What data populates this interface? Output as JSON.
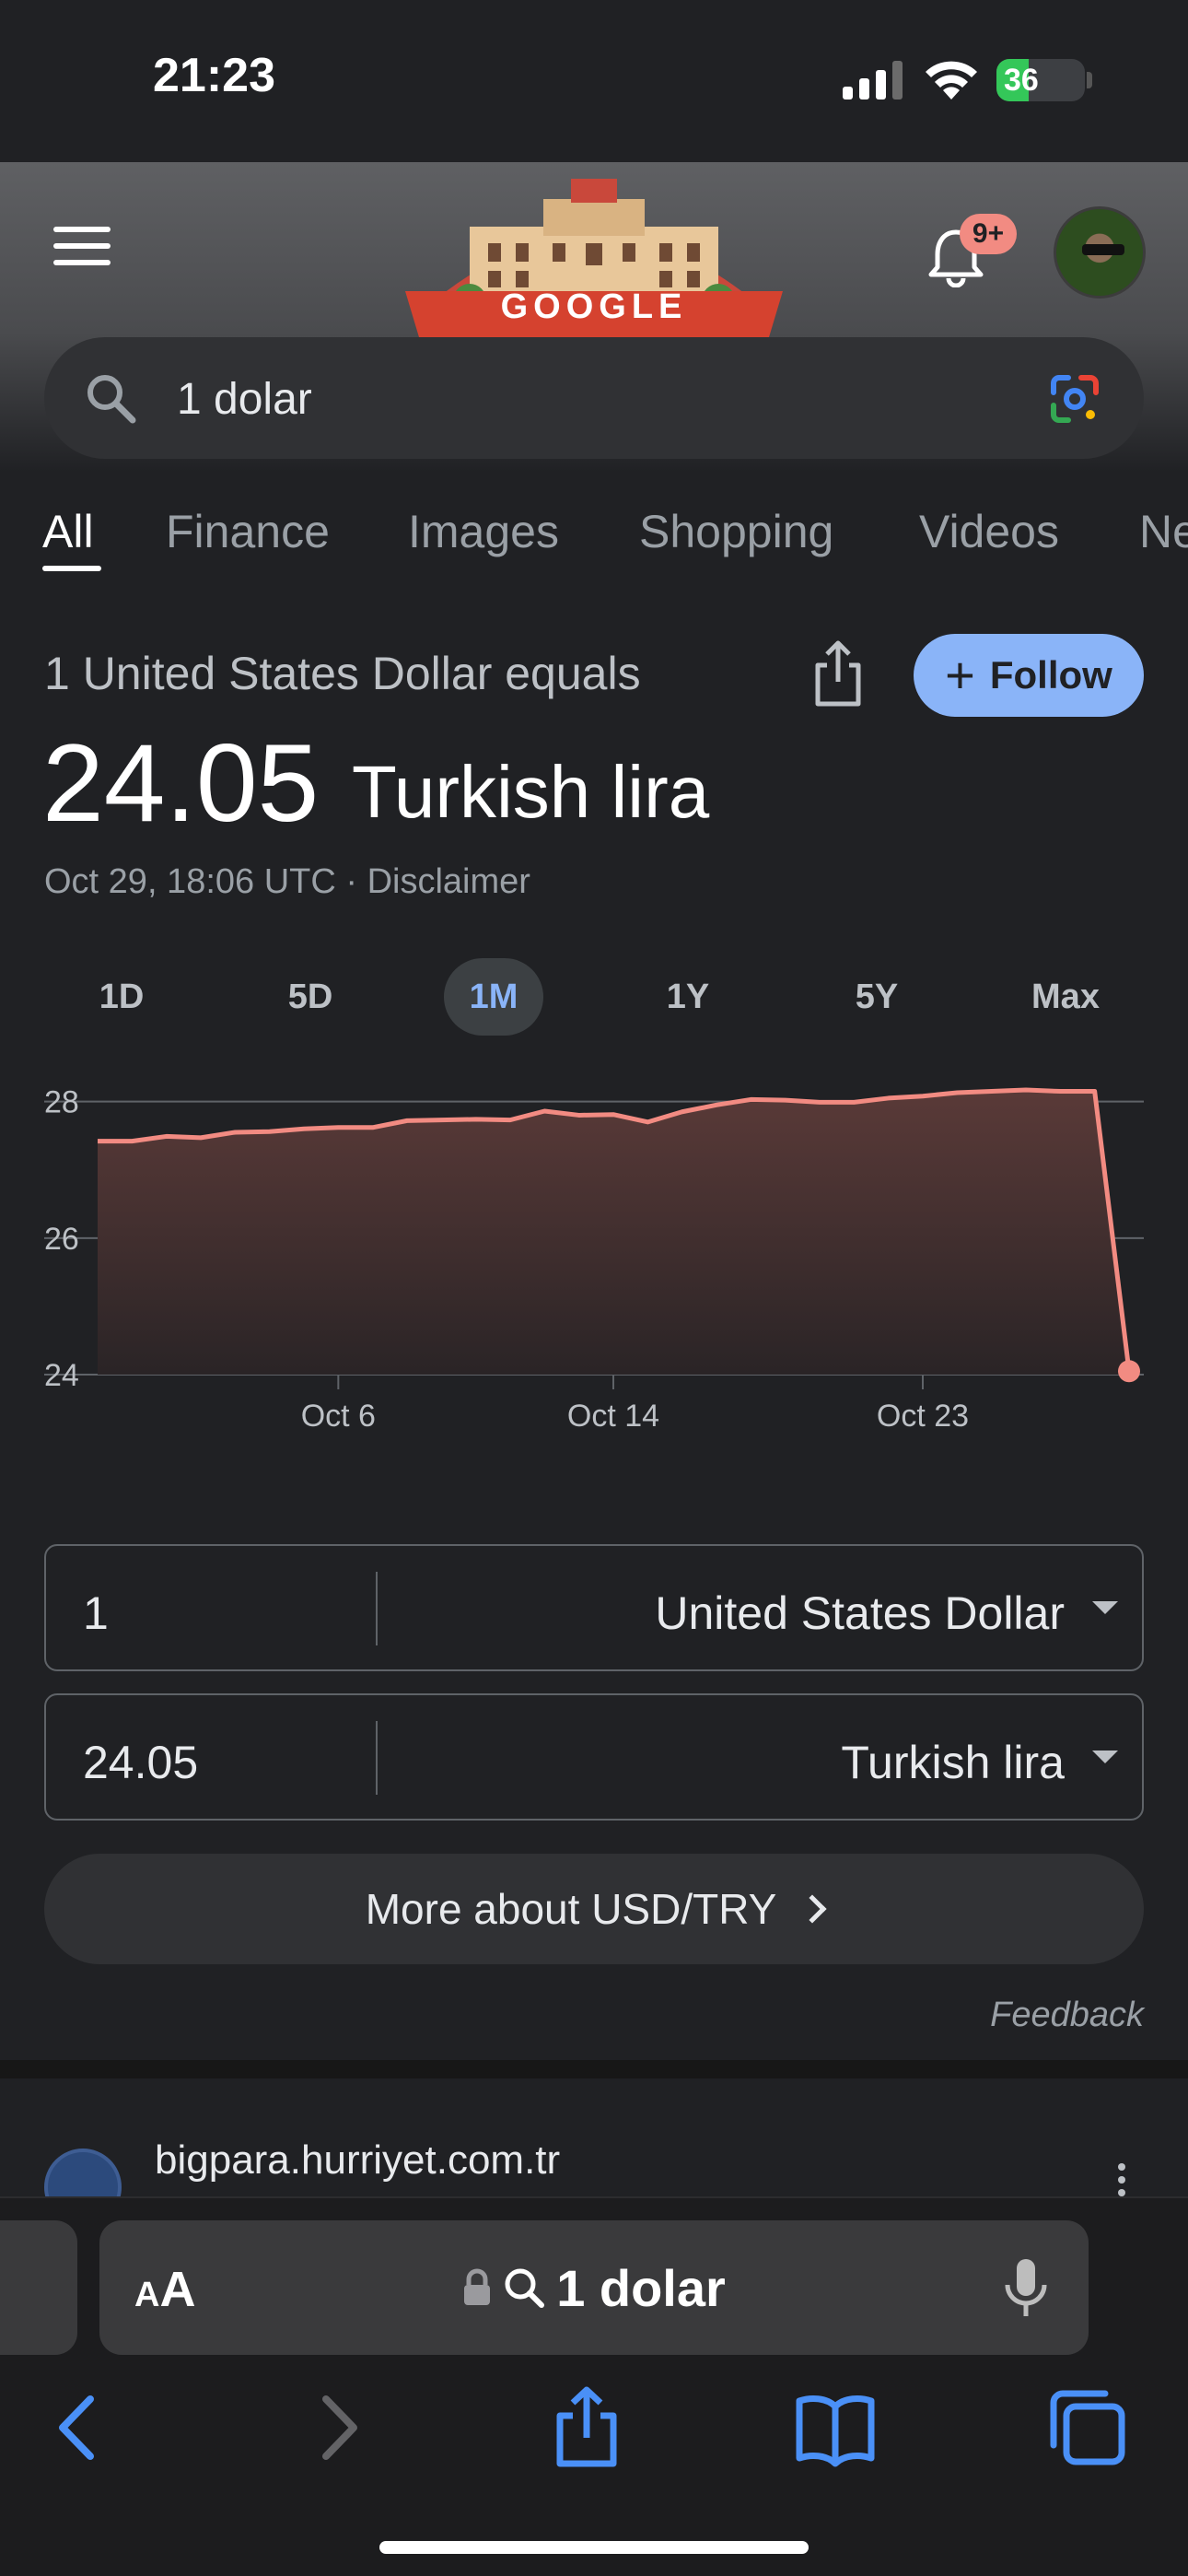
{
  "status_bar": {
    "time": "21:23",
    "battery": "36",
    "battery_level": 0.36
  },
  "header": {
    "doodle_text": "GOOGLE",
    "notification_badge": "9+",
    "search": {
      "query": "1 dolar"
    }
  },
  "tabs": [
    {
      "label": "All",
      "active": true
    },
    {
      "label": "Finance"
    },
    {
      "label": "Images"
    },
    {
      "label": "Shopping"
    },
    {
      "label": "Videos"
    },
    {
      "label": "News"
    }
  ],
  "currency_card": {
    "equals_label": "1 United States Dollar equals",
    "follow_label": "Follow",
    "follow_plus": "+",
    "rate_value": "24.05",
    "rate_unit": "Turkish lira",
    "timestamp": "Oct 29, 18:06 UTC",
    "separator": "·",
    "disclaimer": "Disclaimer",
    "ranges": [
      {
        "label": "1D"
      },
      {
        "label": "5D"
      },
      {
        "label": "1M",
        "active": true
      },
      {
        "label": "1Y"
      },
      {
        "label": "5Y"
      },
      {
        "label": "Max"
      }
    ],
    "converter": [
      {
        "value": "1",
        "currency": "United States Dollar"
      },
      {
        "value": "24.05",
        "currency": "Turkish lira"
      }
    ],
    "more_label": "More about USD/TRY",
    "feedback": "Feedback"
  },
  "chart_data": {
    "type": "area",
    "ylim": [
      24,
      28.4
    ],
    "yticks": [
      28,
      26,
      24
    ],
    "xticks": [
      "Oct 6",
      "Oct 14",
      "Oct 23"
    ],
    "xlim": [
      0,
      30
    ],
    "xtick_positions": [
      7,
      15,
      24
    ],
    "x": [
      0,
      1,
      2,
      3,
      4,
      5,
      6,
      7,
      8,
      9,
      10,
      11,
      12,
      13,
      14,
      15,
      16,
      17,
      18,
      19,
      20,
      21,
      22,
      23,
      24,
      25,
      26,
      27,
      28,
      29,
      30
    ],
    "values": [
      27.42,
      27.42,
      27.49,
      27.47,
      27.55,
      27.56,
      27.6,
      27.62,
      27.62,
      27.72,
      27.73,
      27.74,
      27.73,
      27.86,
      27.8,
      27.81,
      27.7,
      27.85,
      27.95,
      28.03,
      28.02,
      27.99,
      27.99,
      28.05,
      28.08,
      28.13,
      28.15,
      28.17,
      28.15,
      28.15,
      24.05
    ],
    "line_color": "#f28b82",
    "grid": true
  },
  "result": {
    "domain": "bigpara.hurriyet.com.tr"
  },
  "safari": {
    "aa_small": "A",
    "aa_large": "A",
    "address": "1 dolar"
  },
  "colors": {
    "accent": "#8ab4f8",
    "chart_line": "#f28b82",
    "background": "#202124"
  },
  "icons": [
    "menu-icon",
    "bell-icon",
    "search-icon",
    "lens-icon",
    "share-icon",
    "lock-icon",
    "mic-icon",
    "back-icon",
    "forward-icon",
    "bookmarks-icon",
    "tabs-icon"
  ]
}
